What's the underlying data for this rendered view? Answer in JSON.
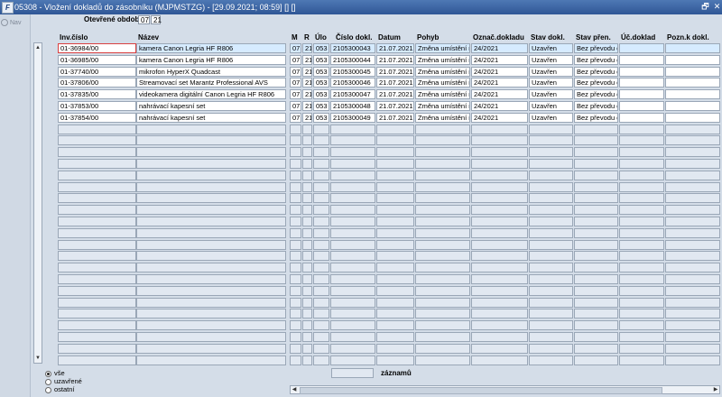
{
  "window": {
    "app_icon": "F",
    "title": "05308 - Vložení dokladů do zásobníku (MJPMSTZG) - [29.09.2021; 08:59] [] []",
    "restore_glyph": "🗗",
    "close_glyph": "✕"
  },
  "sidebar": {
    "nav_label": "Nav",
    "nav_icon": "nav-icon"
  },
  "period": {
    "label": "Otevřené období",
    "month": "07",
    "year": "21"
  },
  "columns": [
    "Inv.číslo",
    "Název",
    "M",
    "R",
    "Úlo",
    "Číslo dokl.",
    "Datum",
    "Pohyb",
    "Označ.dokladu",
    "Stav dokl.",
    "Stav přen.",
    "Úč.doklad",
    "Pozn.k dokl."
  ],
  "rows": [
    [
      "01-36984/00",
      "kamera Canon Legria HF R806",
      "07",
      "21",
      "053",
      "2105300043",
      "21.07.2021",
      "Změna umístění n",
      "24/2021",
      "Uzavřen",
      "Bez převodu d",
      "",
      ""
    ],
    [
      "01-36985/00",
      "kamera Canon Legria HF R806",
      "07",
      "21",
      "053",
      "2105300044",
      "21.07.2021",
      "Změna umístění n",
      "24/2021",
      "Uzavřen",
      "Bez převodu d",
      "",
      ""
    ],
    [
      "01-37740/00",
      "mikrofon HyperX Quadcast",
      "07",
      "21",
      "053",
      "2105300045",
      "21.07.2021",
      "Změna umístění n",
      "24/2021",
      "Uzavřen",
      "Bez převodu d",
      "",
      ""
    ],
    [
      "01-37806/00",
      "Streamovací set Marantz Professional AVS",
      "07",
      "21",
      "053",
      "2105300046",
      "21.07.2021",
      "Změna umístění n",
      "24/2021",
      "Uzavřen",
      "Bez převodu d",
      "",
      ""
    ],
    [
      "01-37835/00",
      "videokamera digitální Canon Legria HF R806",
      "07",
      "21",
      "053",
      "2105300047",
      "21.07.2021",
      "Změna umístění n",
      "24/2021",
      "Uzavřen",
      "Bez převodu d",
      "",
      ""
    ],
    [
      "01-37853/00",
      "nahrávací kapesní set",
      "07",
      "21",
      "053",
      "2105300048",
      "21.07.2021",
      "Změna umístění n",
      "24/2021",
      "Uzavřen",
      "Bez převodu d",
      "",
      ""
    ],
    [
      "01-37854/00",
      "nahrávací kapesní set",
      "07",
      "21",
      "053",
      "2105300049",
      "21.07.2021",
      "Změna umístění n",
      "24/2021",
      "Uzavřen",
      "Bez převodu d",
      "",
      ""
    ]
  ],
  "total_rows_shown": 28,
  "filter_options": [
    {
      "label": "vše",
      "selected": true
    },
    {
      "label": "uzavřené",
      "selected": false
    },
    {
      "label": "ostatní",
      "selected": false
    }
  ],
  "records": {
    "label": "záznamů",
    "count": ""
  },
  "scroll": {
    "up_glyph": "▲",
    "down_glyph": "▼",
    "left_glyph": "◀",
    "right_glyph": "▶"
  },
  "colors": {
    "titlebar": "#2f5796",
    "background": "#d4dde8",
    "focus_border": "#d94040"
  }
}
